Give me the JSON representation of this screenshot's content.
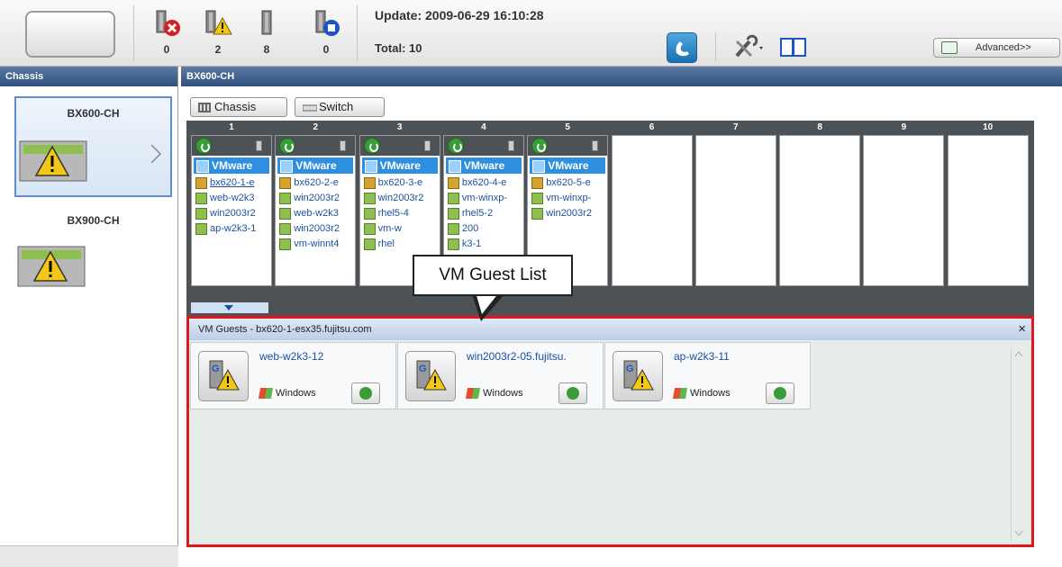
{
  "toolbar": {
    "status_counts": [
      {
        "icon": "server-error-icon",
        "count": "0"
      },
      {
        "icon": "server-warning-icon",
        "count": "2"
      },
      {
        "icon": "server-normal-icon",
        "count": "8"
      },
      {
        "icon": "server-unknown-icon",
        "count": "0"
      }
    ],
    "update": "Update: 2009-06-29 16:10:28",
    "total": "Total: 10",
    "advanced_label": "Advanced>>"
  },
  "left_panel": {
    "header": "Chassis",
    "chassis": [
      {
        "name": "BX600-CH",
        "selected": true,
        "status": "warning"
      },
      {
        "name": "BX900-CH",
        "selected": false,
        "status": "warning"
      }
    ]
  },
  "right_panel": {
    "header": "BX600-CH",
    "tabs": [
      {
        "label": "Chassis",
        "icon": "chassis-icon"
      },
      {
        "label": "Switch",
        "icon": "switch-icon"
      }
    ],
    "slot_numbers": [
      "1",
      "2",
      "3",
      "4",
      "5",
      "6",
      "7",
      "8",
      "9",
      "10"
    ],
    "blades": [
      {
        "vmware": "VMware",
        "lines": [
          "bx620-1-e",
          "web-w2k3",
          "win2003r2",
          "ap-w2k3-1"
        ]
      },
      {
        "vmware": "VMware",
        "lines": [
          "bx620-2-e",
          "win2003r2",
          "web-w2k3",
          "win2003r2",
          "vm-winnt4"
        ]
      },
      {
        "vmware": "VMware",
        "lines": [
          "bx620-3-e",
          "win2003r2",
          "rhel5-4",
          "vm-w",
          "rhel"
        ]
      },
      {
        "vmware": "VMware",
        "lines": [
          "bx620-4-e",
          "vm-winxp-",
          "rhel5-2",
          "200",
          "k3-1"
        ]
      },
      {
        "vmware": "VMware",
        "lines": [
          "bx620-5-e",
          "vm-winxp-",
          "win2003r2"
        ]
      }
    ]
  },
  "callout": "VM Guest List",
  "vm_panel": {
    "title": "VM Guests - bx620-1-esx35.fujitsu.com",
    "close": "×",
    "guests": [
      {
        "name": "web-w2k3-12",
        "os": "Windows"
      },
      {
        "name": "win2003r2-05.fujitsu.",
        "os": "Windows"
      },
      {
        "name": "ap-w2k3-11",
        "os": "Windows"
      }
    ]
  },
  "colors": {
    "accent": "#2e8fe0",
    "header": "#2f4f7f",
    "highlight_border": "#e0181e",
    "link": "#1c4f9e"
  }
}
